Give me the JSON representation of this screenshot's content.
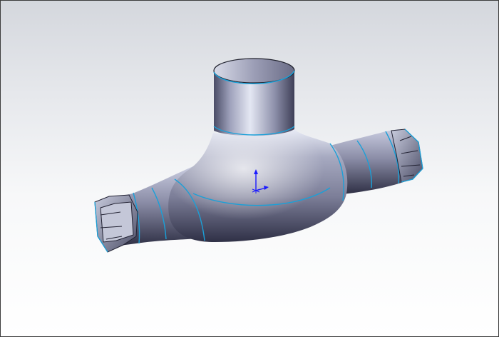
{
  "viewport": {
    "background_top": "#d4d7dd",
    "background_bottom": "#ffffff",
    "border_color": "#3c3c3c"
  },
  "model": {
    "body_color_light": "#e3e6f3",
    "body_color_mid": "#8c8ea6",
    "body_color_dark": "#3a3b52",
    "edge_color": "#1aa0d8",
    "end_cap_edge_color": "#222233"
  },
  "triad": {
    "color": "#1a1aff",
    "icon": "coordinate-triad-icon"
  }
}
